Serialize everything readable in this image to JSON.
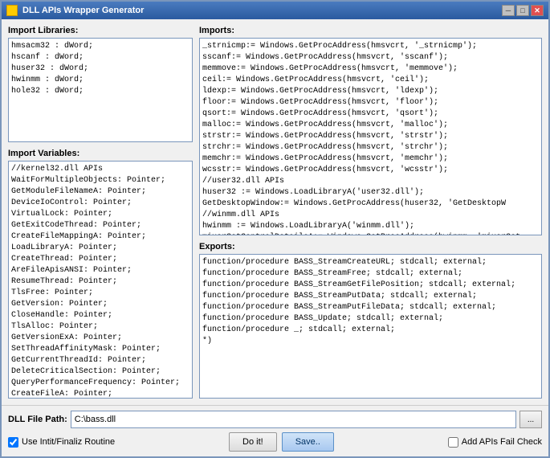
{
  "window": {
    "title": "DLL APIs Wrapper Generator",
    "min_label": "─",
    "max_label": "□",
    "close_label": "✕"
  },
  "left": {
    "import_libs_label": "Import Libraries:",
    "import_libs_content": "hmsacm32 : dWord;\nhscanf : dWord;\nhuser32 : dWord;\nhwinmm : dWord;\nhole32 : dWord;",
    "import_vars_label": "Import Variables:",
    "import_vars_content": "//kernel32.dll APIs\nWaitForMultipleObjects: Pointer;\nGetModuleFileNameA: Pointer;\nDeviceIoControl: Pointer;\nVirtualLock: Pointer;\nGetExitCodeThread: Pointer;\nCreateFileMappingA: Pointer;\nLoadLibraryA: Pointer;\nCreateThread: Pointer;\nAreFileApisANSI: Pointer;\nResumeThread: Pointer;\nTlsFree: Pointer;\nGetVersion: Pointer;\nCloseHandle: Pointer;\nTlsAlloc: Pointer;\nGetVersionExA: Pointer;\nSetThreadAffinityMask: Pointer;\nGetCurrentThreadId: Pointer;\nDeleteCriticalSection: Pointer;\nQueryPerformanceFrequency: Pointer;\nCreateFileA: Pointer;\nGetFileSize: Pointer;"
  },
  "right": {
    "imports_label": "Imports:",
    "imports_content": "_strnicmp:= Windows.GetProcAddress(hmsvcrt, '_strnicmp');\nsscanf:= Windows.GetProcAddress(hmsvcrt, 'sscanf');\nmemmove:= Windows.GetProcAddress(hmsvcrt, 'memmove');\nceil:= Windows.GetProcAddress(hmsvcrt, 'ceil');\nldexp:= Windows.GetProcAddress(hmsvcrt, 'ldexp');\nfloor:= Windows.GetProcAddress(hmsvcrt, 'floor');\nqsort:= Windows.GetProcAddress(hmsvcrt, 'qsort');\nmalloc:= Windows.GetProcAddress(hmsvcrt, 'malloc');\nstrstr:= Windows.GetProcAddress(hmsvcrt, 'strstr');\nstrchr:= Windows.GetProcAddress(hmsvcrt, 'strchr');\nmemchr:= Windows.GetProcAddress(hmsvcrt, 'memchr');\nwcsstr:= Windows.GetProcAddress(hmsvcrt, 'wcsstr');\n//user32.dll APIs\nhuser32 := Windows.LoadLibraryA('user32.dll');\nGetDesktopWindow:= Windows.GetProcAddress(huser32, 'GetDesktopW\n//winmm.dll APIs\nhwinmm := Windows.LoadLibraryA('winmm.dll');\nmixerGetControlDetailsA:= Windows.GetProcAddress(hwinmm, 'mixerGet",
    "exports_label": "Exports:",
    "exports_content": "function/procedure BASS_StreamCreateURL; stdcall; external;\nfunction/procedure BASS_StreamFree; stdcall; external;\nfunction/procedure BASS_StreamGetFilePosition; stdcall; external;\nfunction/procedure BASS_StreamPutData; stdcall; external;\nfunction/procedure BASS_StreamPutFileData; stdcall; external;\nfunction/procedure BASS_Update; stdcall; external;\nfunction/procedure _; stdcall; external;\n*)"
  },
  "bottom": {
    "dll_path_label": "DLL File Path:",
    "dll_path_value": "C:\\bass.dll",
    "browse_label": "...",
    "checkbox1_label": "Use Intit/Finaliz Routine",
    "do_it_label": "Do it!",
    "save_label": "Save..",
    "checkbox2_label": "Add APIs Fail Check"
  }
}
